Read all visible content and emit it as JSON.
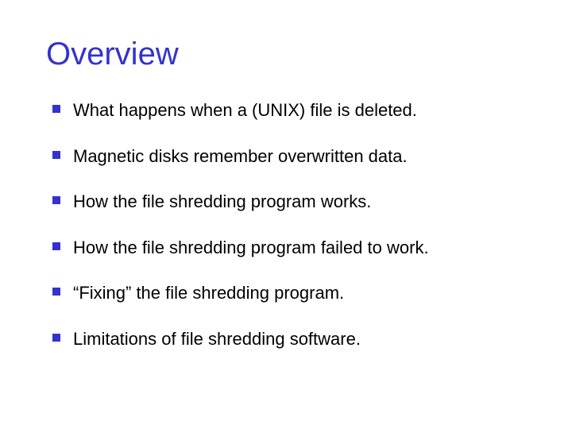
{
  "title": "Overview",
  "bullets": [
    "What happens when a (UNIX) file is deleted.",
    "Magnetic disks remember overwritten data.",
    "How the file shredding program works.",
    "How the file shredding program failed to work.",
    "“Fixing” the file shredding program.",
    "Limitations of file shredding software."
  ]
}
